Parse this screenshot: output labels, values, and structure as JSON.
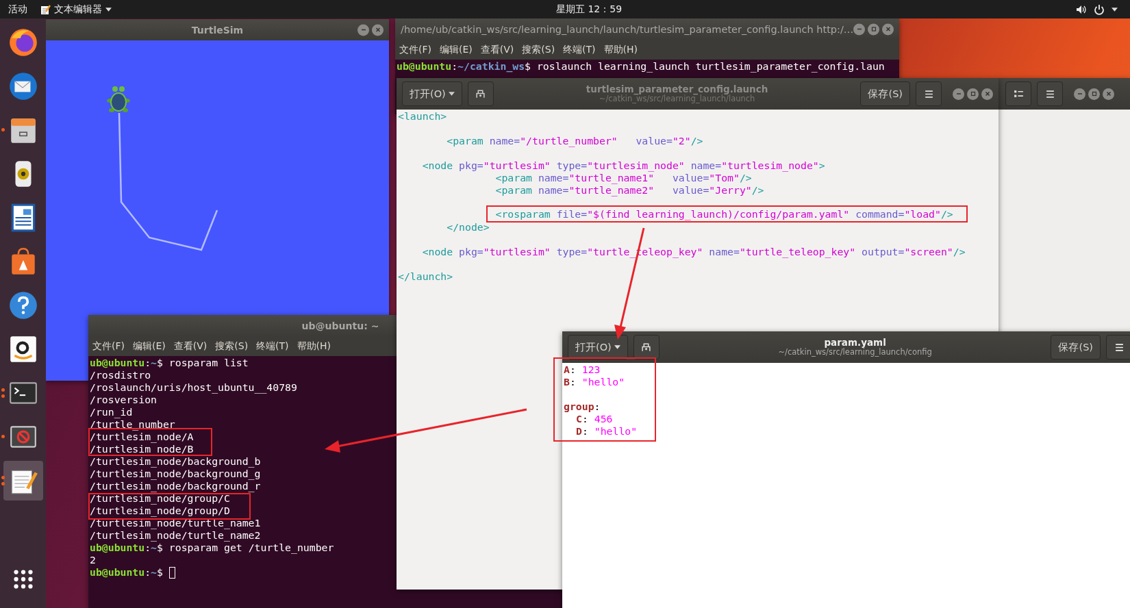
{
  "top_bar": {
    "activities": "活动",
    "app_menu": "文本编辑器",
    "clock": "星期五 12：59"
  },
  "dock": [
    {
      "running": false,
      "several_windows": false,
      "selected": false
    },
    {
      "running": false,
      "several_windows": false,
      "selected": false
    },
    {
      "running": true,
      "several_windows": false,
      "selected": false
    },
    {
      "running": false,
      "several_windows": false,
      "selected": false
    },
    {
      "running": false,
      "several_windows": false,
      "selected": false
    },
    {
      "running": false,
      "several_windows": false,
      "selected": false
    },
    {
      "running": false,
      "several_windows": false,
      "selected": false
    },
    {
      "running": false,
      "several_windows": false,
      "selected": false
    },
    {
      "running": true,
      "several_windows": true,
      "selected": false
    },
    {
      "running": true,
      "several_windows": false,
      "selected": false
    },
    {
      "running": true,
      "several_windows": true,
      "selected": true
    },
    {
      "running": false,
      "several_windows": false,
      "selected": false
    }
  ],
  "turtlesim": {
    "title": "TurtleSim"
  },
  "launch_terminal": {
    "title": "/home/ub/catkin_ws/src/learning_launch/launch/turtlesim_parameter_config.launch http:/…",
    "menu": [
      "文件(F)",
      "编辑(E)",
      "查看(V)",
      "搜索(S)",
      "终端(T)",
      "帮助(H)"
    ],
    "lines": [
      {
        "segments": [
          {
            "kind": "user",
            "text": "ub@ubuntu"
          },
          {
            "kind": "plain",
            "text": ":"
          },
          {
            "kind": "path",
            "text": "~/catkin_ws"
          },
          {
            "kind": "plain",
            "text": "$ roslaunch learning_launch turtlesim_parameter_config.laun"
          }
        ]
      }
    ]
  },
  "launch_editor": {
    "open_button": "打开(O)",
    "title": "turtlesim_parameter_config.launch",
    "subtitle": "~/catkin_ws/src/learning_launch/launch",
    "save_button": "保存(S)",
    "lines": [
      {
        "kind": "code",
        "segments": [
          {
            "kind": "tag",
            "text": "<launch>"
          }
        ]
      },
      {
        "kind": "blank"
      },
      {
        "kind": "code",
        "segments": [
          {
            "kind": "tag",
            "text": "        <param"
          },
          {
            "kind": "attr",
            "text": " name="
          },
          {
            "kind": "string",
            "text": "\"/turtle_number\""
          },
          {
            "kind": "attr",
            "text": "   value="
          },
          {
            "kind": "string",
            "text": "\"2\""
          },
          {
            "kind": "tag",
            "text": "/>"
          }
        ]
      },
      {
        "kind": "blank"
      },
      {
        "kind": "code",
        "segments": [
          {
            "kind": "tag",
            "text": "    <node"
          },
          {
            "kind": "attr",
            "text": " pkg="
          },
          {
            "kind": "string",
            "text": "\"turtlesim\""
          },
          {
            "kind": "attr",
            "text": " type="
          },
          {
            "kind": "string",
            "text": "\"turtlesim_node\""
          },
          {
            "kind": "attr",
            "text": " name="
          },
          {
            "kind": "string",
            "text": "\"turtlesim_node\""
          },
          {
            "kind": "tag",
            "text": ">"
          }
        ]
      },
      {
        "kind": "code",
        "segments": [
          {
            "kind": "tag",
            "text": "                <param"
          },
          {
            "kind": "attr",
            "text": " name="
          },
          {
            "kind": "string",
            "text": "\"turtle_name1\""
          },
          {
            "kind": "attr",
            "text": "   value="
          },
          {
            "kind": "string",
            "text": "\"Tom\""
          },
          {
            "kind": "tag",
            "text": "/>"
          }
        ]
      },
      {
        "kind": "code",
        "segments": [
          {
            "kind": "tag",
            "text": "                <param"
          },
          {
            "kind": "attr",
            "text": " name="
          },
          {
            "kind": "string",
            "text": "\"turtle_name2\""
          },
          {
            "kind": "attr",
            "text": "   value="
          },
          {
            "kind": "string",
            "text": "\"Jerry\""
          },
          {
            "kind": "tag",
            "text": "/>"
          }
        ]
      },
      {
        "kind": "blank"
      },
      {
        "kind": "code",
        "highlighted": true,
        "segments": [
          {
            "kind": "tag",
            "text": "                <rosparam"
          },
          {
            "kind": "attr",
            "text": " file="
          },
          {
            "kind": "string",
            "text": "\"$(find learning_launch)/config/param.yaml\""
          },
          {
            "kind": "attr",
            "text": " command="
          },
          {
            "kind": "string",
            "text": "\"load\""
          },
          {
            "kind": "tag",
            "text": "/>"
          }
        ]
      },
      {
        "kind": "code",
        "segments": [
          {
            "kind": "tag",
            "text": "        </node>"
          }
        ]
      },
      {
        "kind": "blank"
      },
      {
        "kind": "code",
        "segments": [
          {
            "kind": "tag",
            "text": "    <node"
          },
          {
            "kind": "attr",
            "text": " pkg="
          },
          {
            "kind": "string",
            "text": "\"turtlesim\""
          },
          {
            "kind": "attr",
            "text": " type="
          },
          {
            "kind": "string",
            "text": "\"turtle_teleop_key\""
          },
          {
            "kind": "attr",
            "text": " name="
          },
          {
            "kind": "string",
            "text": "\"turtle_teleop_key\""
          },
          {
            "kind": "attr",
            "text": " output="
          },
          {
            "kind": "string",
            "text": "\"screen\""
          },
          {
            "kind": "tag",
            "text": "/>"
          }
        ]
      },
      {
        "kind": "blank"
      },
      {
        "kind": "code",
        "segments": [
          {
            "kind": "tag",
            "text": "</launch>"
          }
        ]
      }
    ]
  },
  "shell_terminal": {
    "title": "ub@ubuntu: ~",
    "menu": [
      "文件(F)",
      "编辑(E)",
      "查看(V)",
      "搜索(S)",
      "终端(T)",
      "帮助(H)"
    ],
    "cursor": true,
    "lines": [
      {
        "segments": [
          {
            "kind": "user",
            "text": "ub@ubuntu"
          },
          {
            "kind": "plain",
            "text": ":"
          },
          {
            "kind": "path",
            "text": "~"
          },
          {
            "kind": "plain",
            "text": "$ rosparam list"
          }
        ]
      },
      {
        "segments": [
          {
            "kind": "plain",
            "text": "/rosdistro"
          }
        ]
      },
      {
        "segments": [
          {
            "kind": "plain",
            "text": "/roslaunch/uris/host_ubuntu__40789"
          }
        ]
      },
      {
        "segments": [
          {
            "kind": "plain",
            "text": "/rosversion"
          }
        ]
      },
      {
        "segments": [
          {
            "kind": "plain",
            "text": "/run_id"
          }
        ]
      },
      {
        "segments": [
          {
            "kind": "plain",
            "text": "/turtle_number"
          }
        ]
      },
      {
        "segments": [
          {
            "kind": "plain",
            "text": "/turtlesim_node/A"
          }
        ]
      },
      {
        "segments": [
          {
            "kind": "plain",
            "text": "/turtlesim_node/B"
          }
        ]
      },
      {
        "segments": [
          {
            "kind": "plain",
            "text": "/turtlesim_node/background_b"
          }
        ]
      },
      {
        "segments": [
          {
            "kind": "plain",
            "text": "/turtlesim_node/background_g"
          }
        ]
      },
      {
        "segments": [
          {
            "kind": "plain",
            "text": "/turtlesim_node/background_r"
          }
        ]
      },
      {
        "segments": [
          {
            "kind": "plain",
            "text": "/turtlesim_node/group/C"
          }
        ]
      },
      {
        "segments": [
          {
            "kind": "plain",
            "text": "/turtlesim_node/group/D"
          }
        ]
      },
      {
        "segments": [
          {
            "kind": "plain",
            "text": "/turtlesim_node/turtle_name1"
          }
        ]
      },
      {
        "segments": [
          {
            "kind": "plain",
            "text": "/turtlesim_node/turtle_name2"
          }
        ]
      },
      {
        "segments": [
          {
            "kind": "user",
            "text": "ub@ubuntu"
          },
          {
            "kind": "plain",
            "text": ":"
          },
          {
            "kind": "path",
            "text": "~"
          },
          {
            "kind": "plain",
            "text": "$ rosparam get /turtle_number"
          }
        ]
      },
      {
        "segments": [
          {
            "kind": "plain",
            "text": "2"
          }
        ]
      },
      {
        "segments": [
          {
            "kind": "user",
            "text": "ub@ubuntu"
          },
          {
            "kind": "plain",
            "text": ":"
          },
          {
            "kind": "path",
            "text": "~"
          },
          {
            "kind": "plain",
            "text": "$"
          }
        ]
      }
    ]
  },
  "yaml_editor": {
    "open_button": "打开(O)",
    "title": "param.yaml",
    "subtitle": "~/catkin_ws/src/learning_launch/config",
    "save_button": "保存(S)",
    "lines": [
      {
        "kind": "code",
        "segments": [
          {
            "kind": "key",
            "text": "A"
          },
          {
            "kind": "plain",
            "text": ": "
          },
          {
            "kind": "value",
            "text": "123"
          }
        ]
      },
      {
        "kind": "code",
        "segments": [
          {
            "kind": "key",
            "text": "B"
          },
          {
            "kind": "plain",
            "text": ": "
          },
          {
            "kind": "value",
            "text": "\"hello\""
          }
        ]
      },
      {
        "kind": "blank"
      },
      {
        "kind": "code",
        "segments": [
          {
            "kind": "key",
            "text": "group"
          },
          {
            "kind": "plain",
            "text": ":"
          }
        ],
        "children": [
          {
            "kind": "code",
            "segments": [
              {
                "kind": "key",
                "text": "C"
              },
              {
                "kind": "plain",
                "text": ": "
              },
              {
                "kind": "value",
                "text": "456"
              }
            ]
          },
          {
            "kind": "code",
            "segments": [
              {
                "kind": "key",
                "text": "D"
              },
              {
                "kind": "plain",
                "text": ": "
              },
              {
                "kind": "value",
                "text": "\"hello\""
              }
            ]
          }
        ]
      }
    ]
  }
}
